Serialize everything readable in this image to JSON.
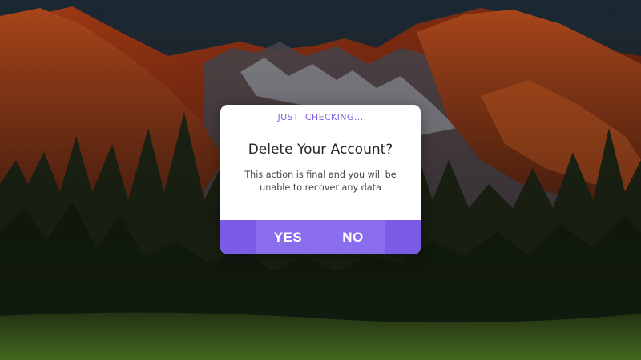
{
  "background": {
    "icon": "mountain-forest-landscape",
    "colors": {
      "sky": "#1c2430",
      "mountain": "#7a2a10",
      "mountain_lit": "#b8451a",
      "snow": "#8b8f98",
      "forest": "#1e2a14",
      "meadow": "#3f6a1f"
    }
  },
  "dialog": {
    "kicker": "JUST  CHECKING...",
    "title": "Delete Your Account?",
    "message": "This action is final and you will be unable to recover any data",
    "yes_label": "YES",
    "no_label": "NO",
    "colors": {
      "accent": "#7b5ce6",
      "button": "#8a6ded",
      "kicker_text": "#7d5fe0"
    }
  }
}
